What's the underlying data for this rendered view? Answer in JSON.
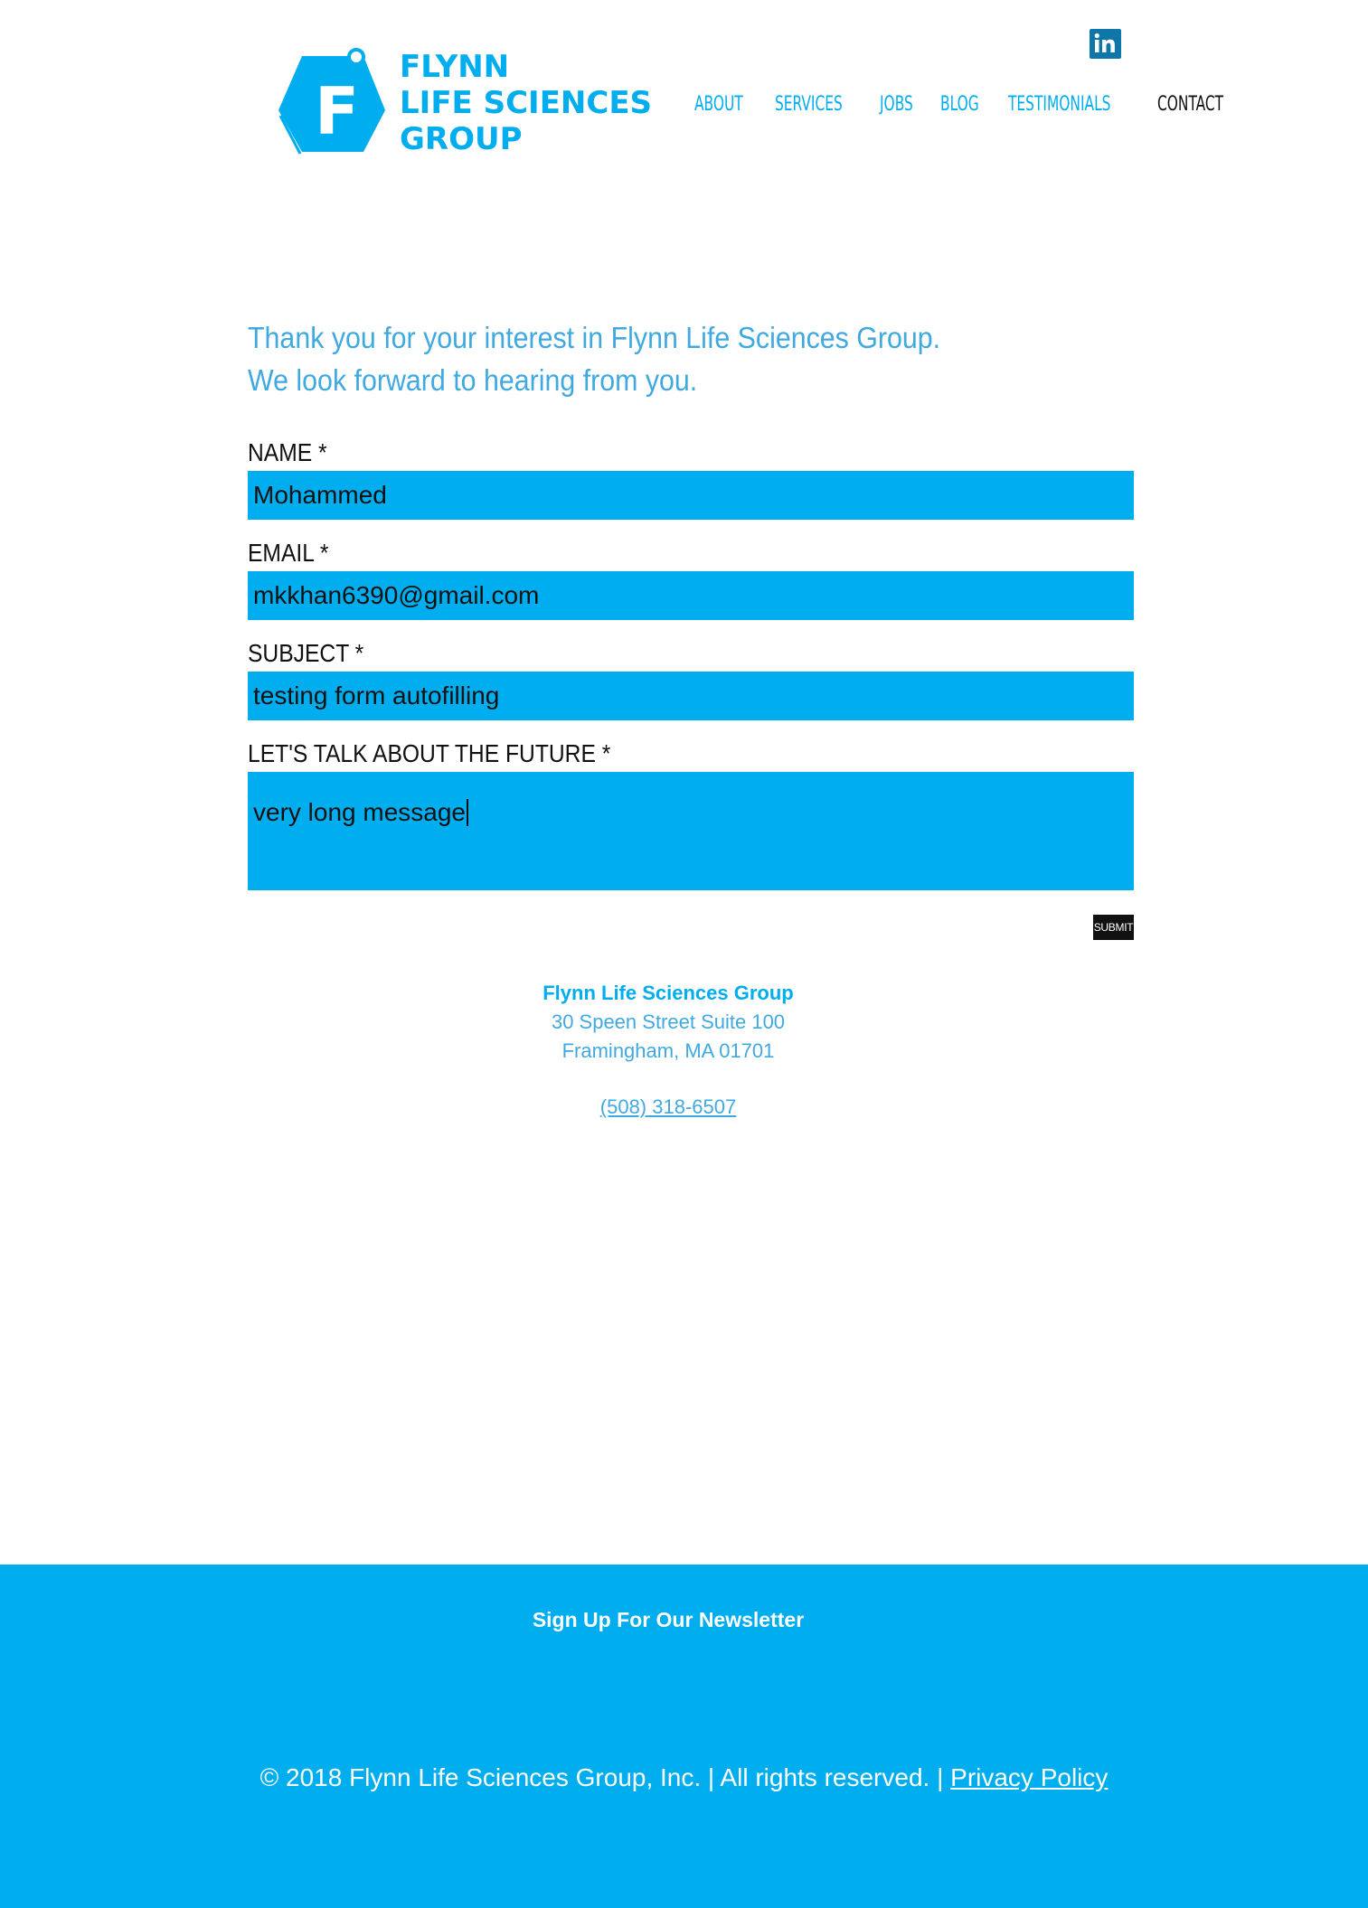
{
  "brand": {
    "logo_letter": "F",
    "name_lines": [
      "FLYNN",
      "LIFE SCIENCES",
      "GROUP"
    ],
    "color": "#00adee"
  },
  "social": {
    "icon": "linkedin-icon",
    "label": "in",
    "color": "#0e76a8"
  },
  "nav": {
    "items": [
      {
        "label": "ABOUT"
      },
      {
        "label": "SERVICES"
      },
      {
        "label": "JOBS"
      },
      {
        "label": "BLOG"
      },
      {
        "label": "TESTIMONIALS"
      },
      {
        "label": "CONTACT",
        "active": true
      }
    ]
  },
  "intro": {
    "line1": "Thank you for your interest in Flynn Life Sciences Group.",
    "line2": "We look forward to hearing from you."
  },
  "form": {
    "name_label": "NAME *",
    "name_value": "Mohammed",
    "email_label": "EMAIL *",
    "email_value": "mkkhan6390@gmail.com",
    "subject_label": "SUBJECT *",
    "subject_value": "testing form autofilling",
    "message_label": "LET'S TALK ABOUT THE FUTURE *",
    "message_value": "very long message",
    "submit_label": "SUBMIT",
    "field_color": "#00adee"
  },
  "address": {
    "company": "Flynn Life Sciences Group",
    "street": "30 Speen Street Suite 100",
    "city": "Framingham, MA 01701",
    "phone": "(508) 318-6507"
  },
  "footer": {
    "newsletter_title": "Sign Up For Our Newsletter",
    "copyright": "© 2018 Flynn Life Sciences Group, Inc.  |  All rights reserved.  |  ",
    "privacy_label": "Privacy Policy",
    "background": "#00adee"
  }
}
